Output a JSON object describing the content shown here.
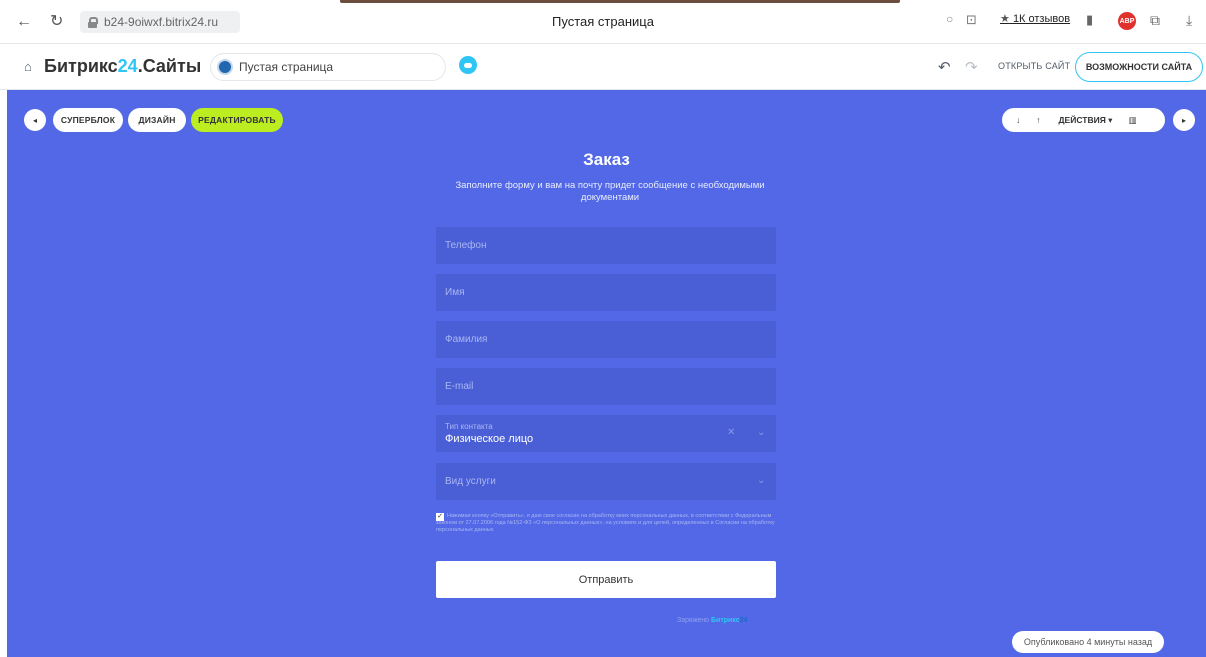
{
  "browser": {
    "url": "b24-9oiwxf.bitrix24.ru",
    "tab_title": "Пустая страница",
    "reviews": "1К отзывов",
    "reviews_star": "★",
    "abp": "ABP",
    "icons": [
      "back-arrow-icon",
      "reload-icon",
      "lock-icon",
      "chat-icon",
      "extension-icon",
      "bookmark-icon",
      "adblock-icon",
      "extension2-icon",
      "download-icon"
    ]
  },
  "header": {
    "brand_prefix": "Битрикс",
    "brand_num": "24",
    "brand_suffix": ".Сайты",
    "page_select": "Пустая страница",
    "open_site": "ОТКРЫТЬ САЙТ",
    "features": "ВОЗМОЖНОСТИ САЙТА"
  },
  "toolbar": {
    "superblock": "СУПЕРБЛОК",
    "design": "ДИЗАЙН",
    "edit": "РЕДАКТИРОВАТЬ",
    "actions": "ДЕЙСТВИЯ"
  },
  "form": {
    "title": "Заказ",
    "subtitle": "Заполните форму и вам на почту придет сообщение с необходимыми документами",
    "fields": {
      "phone": "Телефон",
      "name": "Имя",
      "surname": "Фамилия",
      "email": "E-mail",
      "contact_type_label": "Тип контакта",
      "contact_type_value": "Физическое лицо",
      "service": "Вид услуги"
    },
    "consent": "Нажимая кнопку «Отправить», я даю свое согласие на обработку моих персональных данных, в соответствии с Федеральным законом от 27.07.2006 года №152-ФЗ «О персональных данных», на условиях и для целей, определенных в Согласии на обработку персональных данных",
    "submit": "Отправить",
    "powered_prefix": "Заряжено",
    "powered_bx": "Битрикс",
    "powered_num": "24"
  },
  "status": {
    "published": "Опубликовано 4 минуты назад"
  },
  "colors": {
    "canvas": "#5268e6",
    "field": "#4a5fd6",
    "edit_accent": "#bbed21",
    "brand_accent": "#2fc6f6"
  }
}
